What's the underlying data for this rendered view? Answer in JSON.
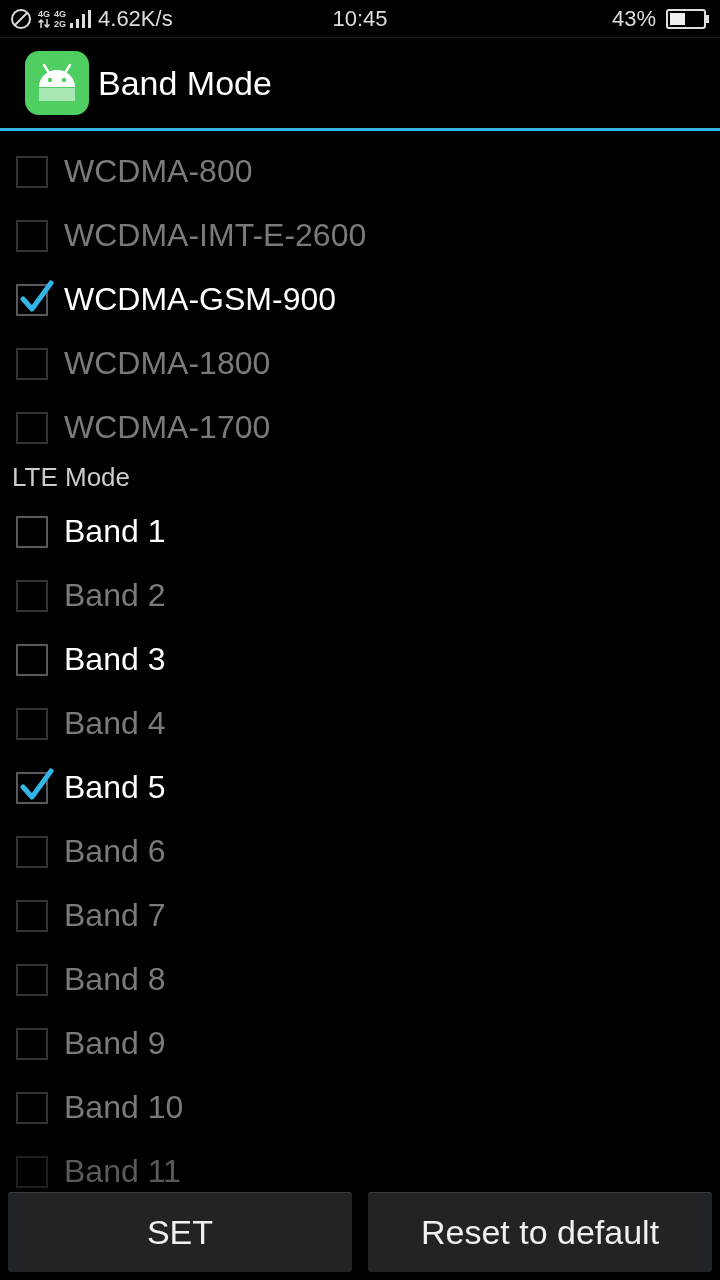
{
  "status_bar": {
    "network_labels": [
      "4G",
      "4G",
      "2G"
    ],
    "speed": "4.62K/s",
    "time": "10:45",
    "battery": "43%"
  },
  "app_bar": {
    "title": "Band Mode"
  },
  "wcdma_bands": [
    {
      "label": "WCDMA-800",
      "checked": false,
      "enabled": false
    },
    {
      "label": "WCDMA-IMT-E-2600",
      "checked": false,
      "enabled": false
    },
    {
      "label": "WCDMA-GSM-900",
      "checked": true,
      "enabled": true
    },
    {
      "label": "WCDMA-1800",
      "checked": false,
      "enabled": false
    },
    {
      "label": "WCDMA-1700",
      "checked": false,
      "enabled": false
    }
  ],
  "lte_section": {
    "title": "LTE Mode",
    "bands": [
      {
        "label": "Band 1",
        "checked": false,
        "enabled": true
      },
      {
        "label": "Band 2",
        "checked": false,
        "enabled": false
      },
      {
        "label": "Band 3",
        "checked": false,
        "enabled": true
      },
      {
        "label": "Band 4",
        "checked": false,
        "enabled": false
      },
      {
        "label": "Band 5",
        "checked": true,
        "enabled": true
      },
      {
        "label": "Band 6",
        "checked": false,
        "enabled": false
      },
      {
        "label": "Band 7",
        "checked": false,
        "enabled": false
      },
      {
        "label": "Band 8",
        "checked": false,
        "enabled": false
      },
      {
        "label": "Band 9",
        "checked": false,
        "enabled": false
      },
      {
        "label": "Band 10",
        "checked": false,
        "enabled": false
      },
      {
        "label": "Band 11",
        "checked": false,
        "enabled": false
      }
    ]
  },
  "buttons": [
    "SET",
    "Reset to default"
  ]
}
